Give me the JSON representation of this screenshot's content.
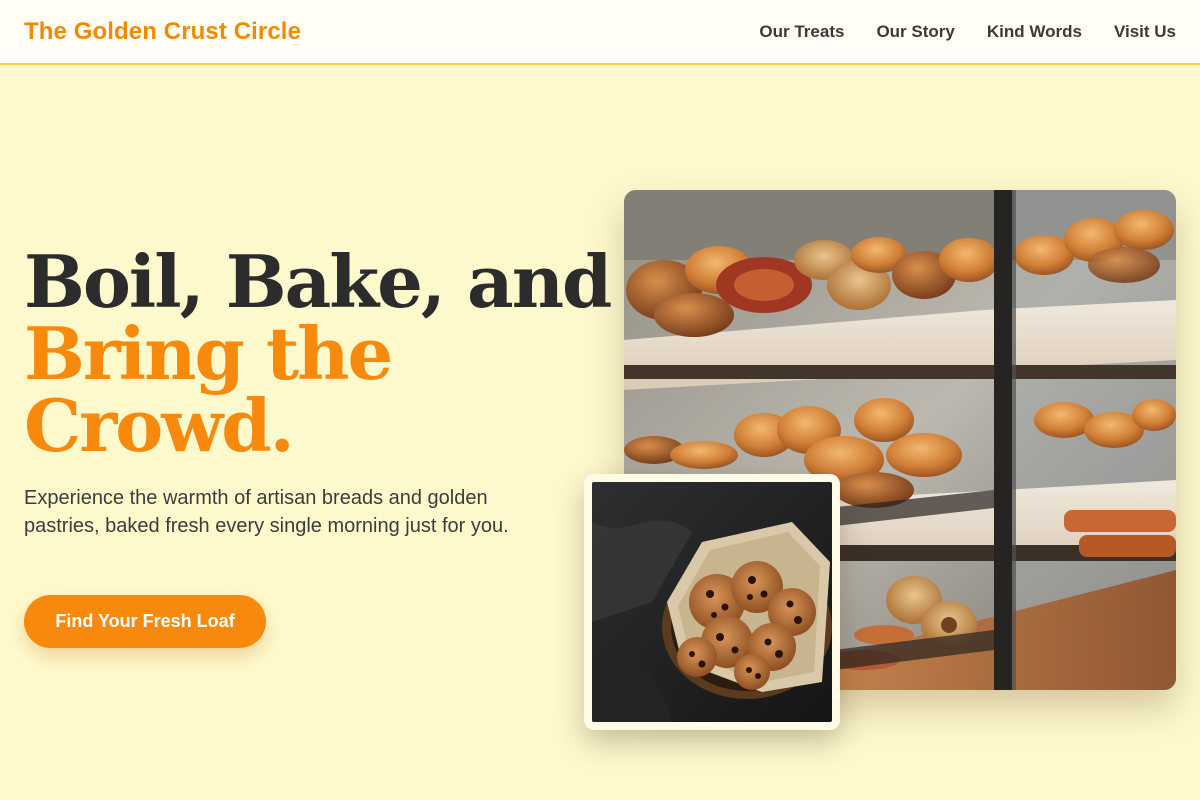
{
  "header": {
    "brand": "The Golden Crust Circle",
    "nav": [
      "Our Treats",
      "Our Story",
      "Kind Words",
      "Visit Us"
    ]
  },
  "hero": {
    "title_line1": "Boil, Bake, and",
    "title_line2": "Bring the",
    "title_line3": "Crowd.",
    "subtitle": "Experience the warmth of artisan breads and golden pastries, baked fresh every single morning just for you.",
    "cta_label": "Find Your Fresh Loaf"
  },
  "colors": {
    "accent": "#f7890c",
    "background": "#fef9cd",
    "header_background": "#fffdf5",
    "header_border": "#f5d547",
    "text_dark": "#2c2c2c"
  },
  "images": {
    "main": "bakery-display-case-photo",
    "inset": "chocolate-chip-cookies-basket-photo"
  }
}
